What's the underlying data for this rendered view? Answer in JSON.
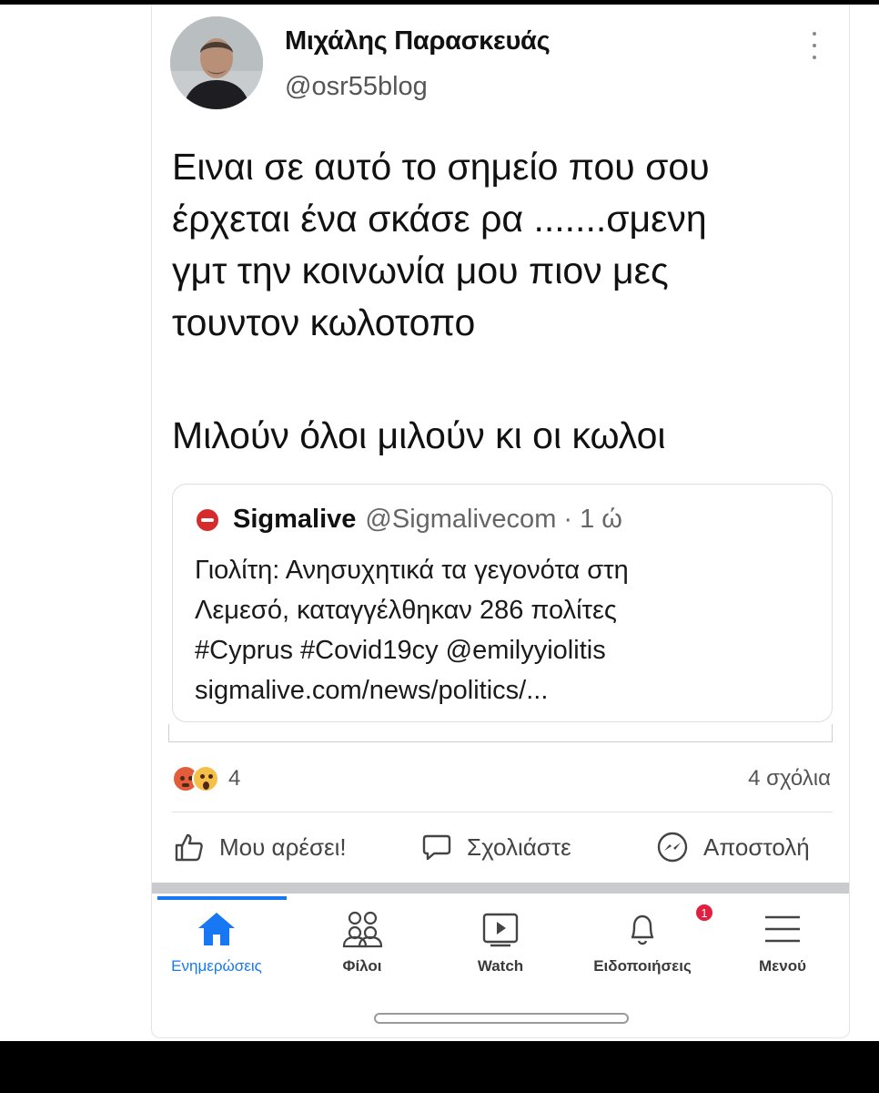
{
  "post": {
    "author_name": "Μιχάλης Παρασκευάς",
    "author_handle": "@osr55blog",
    "text_lines": [
      "Ειναι σε αυτό το σημείο που σου",
      "έρχεται ένα σκάσε ρα .......σμενη",
      "γμτ την κοινωνία μου πιον μες",
      "τουντον κωλοτοπο"
    ],
    "text_line_2": "Μιλούν όλοι μιλούν κι οι κωλοι"
  },
  "quote": {
    "source": "Sigmalive",
    "meta": "@Sigmalivecom · 1 ώ",
    "body_lines": [
      "Γιολίτη: Ανησυχητικά τα γεγονότα στη",
      "Λεμεσό, καταγγέλθηκαν 286 πολίτες",
      "#Cyprus #Covid19cy @emilyyiolitis",
      "sigmalive.com/news/politics/..."
    ]
  },
  "engagement": {
    "reaction_count": "4",
    "comments": "4 σχόλια"
  },
  "actions": {
    "like": "Μου αρέσει!",
    "comment": "Σχολιάστε",
    "share": "Αποστολή"
  },
  "nav": {
    "home": "Ενημερώσεις",
    "friends": "Φίλοι",
    "watch": "Watch",
    "notifications": "Ειδοποιήσεις",
    "notifications_badge": "1",
    "menu": "Μενού"
  },
  "colors": {
    "accent": "#1877f2",
    "badge": "#e41e3f",
    "sigmalive": "#d72a2a"
  }
}
